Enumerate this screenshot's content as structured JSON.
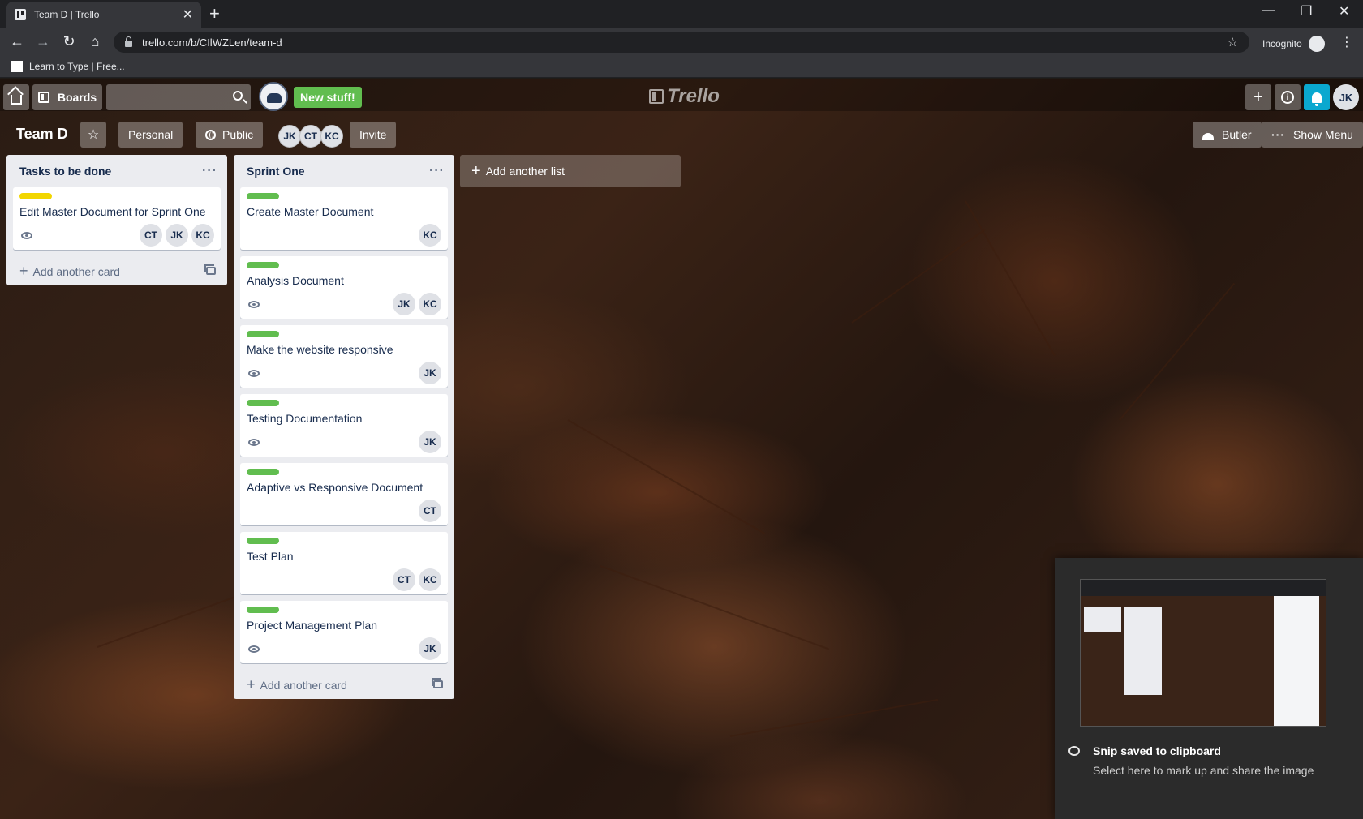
{
  "browser": {
    "tab_title": "Team D | Trello",
    "url": "trello.com/b/CIlWZLen/team-d",
    "profile_label": "Incognito",
    "bookmark_label": "Learn to Type | Free..."
  },
  "trello_header": {
    "boards_label": "Boards",
    "new_stuff_label": "New stuff!",
    "logo_text": "Trello",
    "user_initials": "JK"
  },
  "board": {
    "title": "Team D",
    "team_label": "Personal",
    "visibility_label": "Public",
    "members": [
      "JK",
      "CT",
      "KC"
    ],
    "invite_label": "Invite",
    "butler_label": "Butler",
    "show_menu_label": "Show Menu"
  },
  "lists": [
    {
      "title": "Tasks to be done",
      "add_card_label": "Add another card",
      "cards": [
        {
          "label_color": "#f2d600",
          "title": "Edit Master Document for Sprint One",
          "watching": true,
          "members": [
            "CT",
            "JK",
            "KC"
          ]
        }
      ]
    },
    {
      "title": "Sprint One",
      "add_card_label": "Add another card",
      "cards": [
        {
          "label_color": "#61bd4f",
          "title": "Create Master Document",
          "watching": false,
          "members": [
            "KC"
          ]
        },
        {
          "label_color": "#61bd4f",
          "title": "Analysis Document",
          "watching": true,
          "members": [
            "JK",
            "KC"
          ]
        },
        {
          "label_color": "#61bd4f",
          "title": "Make the website responsive",
          "watching": true,
          "members": [
            "JK"
          ]
        },
        {
          "label_color": "#61bd4f",
          "title": "Testing Documentation",
          "watching": true,
          "members": [
            "JK"
          ]
        },
        {
          "label_color": "#61bd4f",
          "title": "Adaptive vs Responsive Document",
          "watching": false,
          "members": [
            "CT"
          ]
        },
        {
          "label_color": "#61bd4f",
          "title": "Test Plan",
          "watching": false,
          "members": [
            "CT",
            "KC"
          ]
        },
        {
          "label_color": "#61bd4f",
          "title": "Project Management Plan",
          "watching": true,
          "members": [
            "JK"
          ]
        }
      ]
    }
  ],
  "add_list_label": "Add another list",
  "snip_toast": {
    "title": "Snip saved to clipboard",
    "body": "Select here to mark up and share the image"
  },
  "icons": {
    "home": "home-icon",
    "boards": "boards-icon",
    "search": "search-icon",
    "create": "plus-icon",
    "info": "info-icon",
    "notifications": "bell-icon",
    "star": "star-icon",
    "visibility": "globe-icon",
    "watch": "eye-icon",
    "card_template": "template-icon"
  }
}
